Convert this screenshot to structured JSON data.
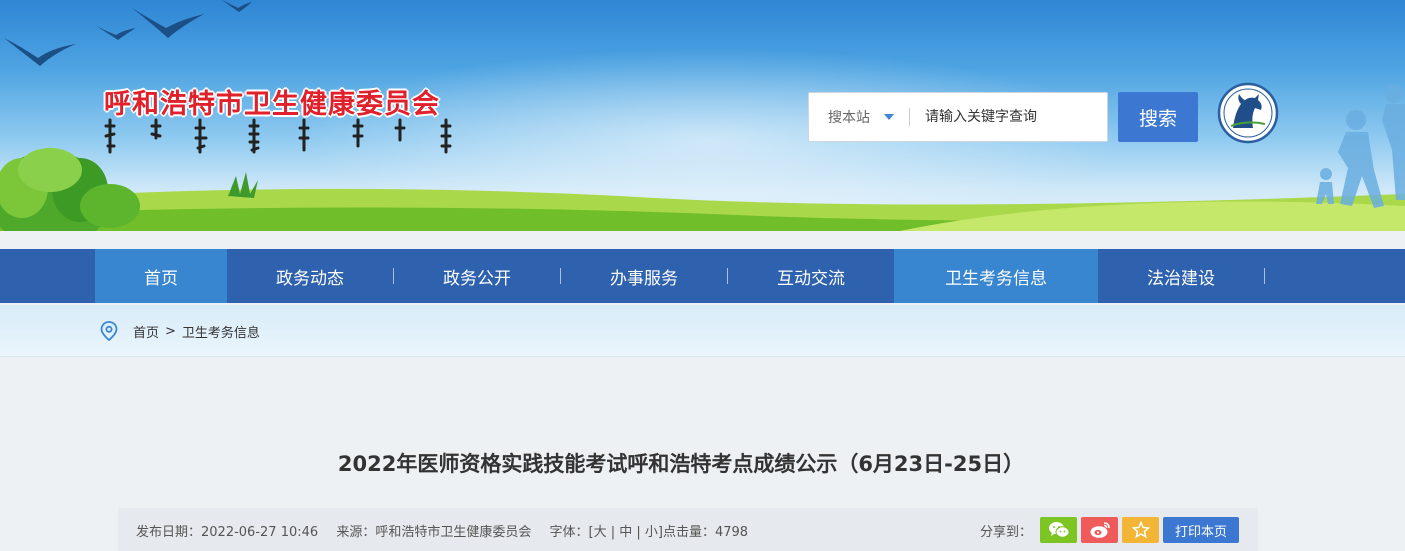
{
  "header": {
    "site_title": "呼和浩特市卫生健康委员会",
    "search": {
      "scope_label": "搜本站",
      "placeholder": "请输入关键字查询",
      "button_label": "搜索"
    }
  },
  "nav": {
    "items": [
      {
        "label": "首页",
        "active": true
      },
      {
        "label": "政务动态",
        "active": false
      },
      {
        "label": "政务公开",
        "active": false
      },
      {
        "label": "办事服务",
        "active": false
      },
      {
        "label": "互动交流",
        "active": false
      },
      {
        "label": "卫生考务信息",
        "active": true
      },
      {
        "label": "法治建设",
        "active": false
      }
    ]
  },
  "breadcrumb": {
    "home": "首页",
    "separator": ">",
    "current": "卫生考务信息"
  },
  "article": {
    "title": "2022年医师资格实践技能考试呼和浩特考点成绩公示（6月23日-25日）",
    "meta": {
      "date_label": "发布日期：",
      "date": "2022-06-27 10:46",
      "source_label": "来源：",
      "source": "呼和浩特市卫生健康委员会",
      "font_label": "字体：",
      "font_options": "[大 | 中 | 小]",
      "views_label": "点击量：",
      "views": "4798"
    },
    "share_label": "分享到：",
    "print_label": "打印本页"
  },
  "colors": {
    "nav_bg": "#2f62ae",
    "nav_active": "#3885d0",
    "title_red": "#e0202a",
    "search_btn": "#3c78d2",
    "wechat": "#7cc522",
    "weibo": "#ef5b5b",
    "favorite": "#f2b535"
  },
  "icons": [
    "location-pin-icon",
    "caret-down-icon",
    "wechat-icon",
    "weibo-icon",
    "star-icon",
    "horse-emblem-icon"
  ]
}
